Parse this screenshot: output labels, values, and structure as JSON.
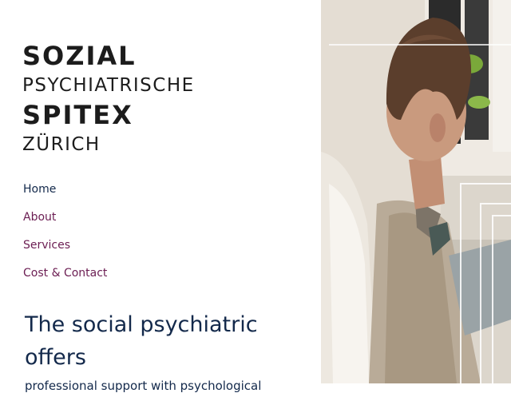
{
  "logo": {
    "line1": "SOZIAL",
    "line2": "PSYCHIATRISCHE",
    "line3": "SPITEX",
    "line4": "ZÜRICH"
  },
  "nav": {
    "items": [
      {
        "label": "Home",
        "active": true
      },
      {
        "label": "About",
        "active": false
      },
      {
        "label": "Services",
        "active": false
      },
      {
        "label": "Cost & Contact",
        "active": false
      }
    ]
  },
  "hero": {
    "heading": "The social psychiatric offers",
    "subtext": "professional support with psychological"
  },
  "colors": {
    "primary_navy": "#13294b",
    "accent_plum": "#6b1d52",
    "logo_dark": "#1c1c1c"
  },
  "photo": {
    "subject": "man-seated-back-view-photo"
  }
}
